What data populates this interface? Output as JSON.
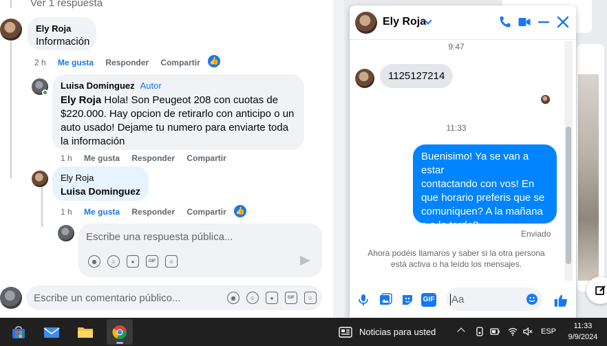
{
  "feed": {
    "view_replies": "Ver 1 respuesta",
    "comment1": {
      "name": "Ely Roja",
      "text": "Información",
      "time": "2 h",
      "like": "Me gusta",
      "reply": "Responder",
      "share": "Compartir"
    },
    "comment2": {
      "name": "Luisa Dominguez",
      "badge": "Autor",
      "mention": "Ely Roja",
      "text_line1": " Hola! Son Peugeot 208 con cuotas de",
      "text_line2": "$220.000. Hay opcion de retirarlo con anticipo o un",
      "text_line3": "auto usado! Dejame tu numero para enviarte toda",
      "text_line4": "la información",
      "time": "1 h",
      "like": "Me gusta",
      "reply": "Responder",
      "share": "Compartir"
    },
    "comment3": {
      "name": "Ely Roja",
      "text": "Luisa Dominguez",
      "time": "1 h",
      "like": "Me gusta",
      "reply": "Responder",
      "share": "Compartir"
    },
    "reply_placeholder": "Escribe una respuesta pública...",
    "comment_placeholder": "Escribe un comentario público...",
    "gif_label": "GIF"
  },
  "chat": {
    "title": "Ely Roja",
    "timestamp1": "9:47",
    "msg_in": "1125127214",
    "timestamp2": "11:33",
    "msg_out_lines": [
      "Buenisimo! Ya se van a estar",
      "contactando con vos! En",
      "que horario preferis que se",
      "comuniquen? A la mañana",
      "o a la tarde?"
    ],
    "status": "Enviado",
    "notice_line1": "Ahora podéis llamaros y saber si la otra persona",
    "notice_line2": "está activa o ha leído los mensajes.",
    "input_placeholder": "Aa",
    "gif_label": "GIF",
    "accent_color": "#0084ff"
  },
  "taskbar": {
    "news": "Noticias para usted",
    "lang": "ESP",
    "time": "11:33",
    "date": "9/9/2024"
  }
}
